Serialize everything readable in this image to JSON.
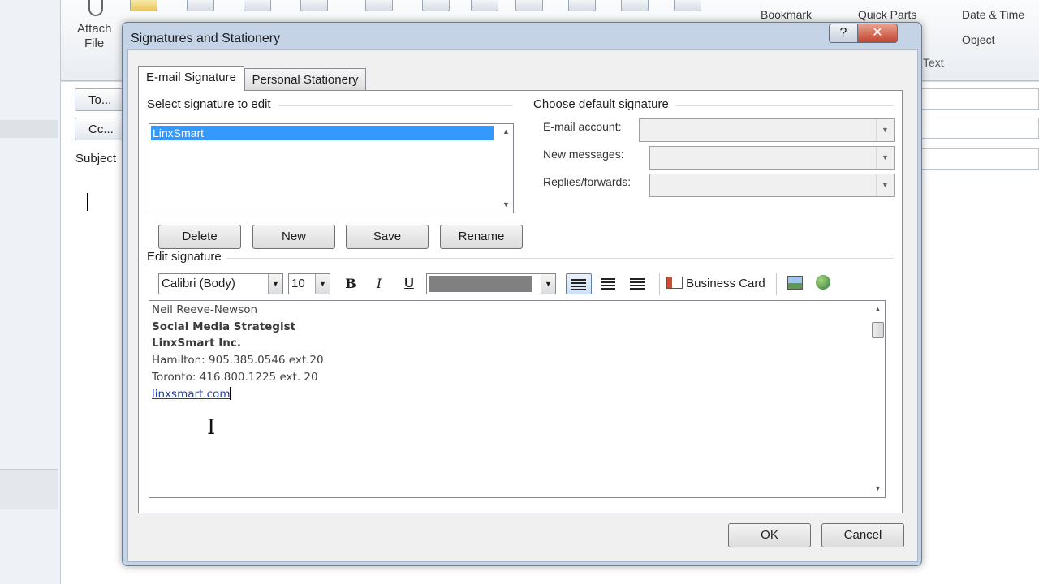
{
  "background_window": {
    "ribbon": {
      "attach_file_label_line1": "Attach",
      "attach_file_label_line2": "File",
      "bookmark_label": "Bookmark",
      "quick_parts_label": "Quick Parts",
      "date_time_label": "Date & Time",
      "object_label": "Object",
      "text_group_label": "Text"
    },
    "to_button_label": "To...",
    "cc_button_label": "Cc...",
    "subject_label": "Subject"
  },
  "dialog": {
    "title": "Signatures and Stationery",
    "help_glyph": "?",
    "close_glyph": "✕",
    "tabs": [
      {
        "label": "E-mail Signature",
        "active": true
      },
      {
        "label": "Personal Stationery",
        "active": false
      }
    ],
    "select_signature": {
      "label": "Select signature to edit",
      "items": [
        {
          "label": "LinxSmart",
          "selected": true
        }
      ],
      "buttons": {
        "delete": "Delete",
        "new": "New",
        "save": "Save",
        "rename": "Rename"
      }
    },
    "default_signature": {
      "label": "Choose default signature",
      "email_account_label": "E-mail account:",
      "email_account_value": "",
      "new_messages_label": "New messages:",
      "new_messages_value": "",
      "replies_forwards_label": "Replies/forwards:",
      "replies_forwards_value": ""
    },
    "edit_signature": {
      "label": "Edit signature",
      "toolbar": {
        "font_family": "Calibri (Body)",
        "font_size": "10",
        "bold_glyph": "B",
        "italic_glyph": "I",
        "underline_glyph": "U",
        "font_color": "#808080",
        "business_card_label": "Business Card",
        "picture_icon": "insert-picture-icon",
        "hyperlink_icon": "insert-hyperlink-icon"
      },
      "signature_text": {
        "name": "Neil Reeve-Newson",
        "title": "Social Media Strategist",
        "company": "LinxSmart Inc.",
        "phone_hamilton": "Hamilton: 905.385.0546 ext.20",
        "phone_toronto": "Toronto: 416.800.1225 ext. 20",
        "website": "linxsmart.com"
      }
    },
    "ok_label": "OK",
    "cancel_label": "Cancel"
  },
  "colors": {
    "selection_blue": "#3399ff",
    "dialog_frame": "#c4d3e6",
    "close_red": "#c4452c",
    "link_blue": "#1f3ea8"
  }
}
